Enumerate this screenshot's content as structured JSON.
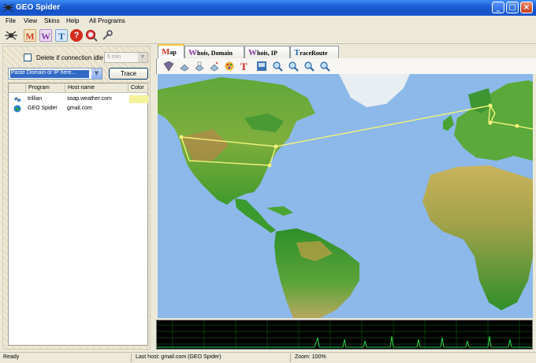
{
  "window": {
    "title": "GEO Spider"
  },
  "menu": [
    "File",
    "View",
    "Skins",
    "Help",
    "All Programs"
  ],
  "toolbar": {
    "buttons": [
      {
        "icon": "spider-icon"
      },
      {
        "icon": "map-m-icon",
        "glyph": "M"
      },
      {
        "icon": "whois-w-icon",
        "glyph": "W"
      },
      {
        "icon": "trace-t-icon",
        "glyph": "T"
      },
      {
        "icon": "help-icon",
        "glyph": "?"
      },
      {
        "icon": "globe-search-icon"
      },
      {
        "icon": "settings-icon"
      }
    ]
  },
  "left_panel": {
    "delete_idle_label": "Delete if connection idle",
    "idle_select_value": "5 min",
    "domain_input_placeholder": "Paste Domain or IP here...",
    "trace_button": "Trace",
    "columns": [
      "Program",
      "Host name",
      "Color"
    ],
    "rows": [
      {
        "program": "trillian",
        "host": "soap.weather.com",
        "color": "#f6f29a"
      },
      {
        "program": "GEO Spider",
        "host": "gmail.com",
        "color": ""
      }
    ]
  },
  "tabs": [
    {
      "first": "M",
      "rest": "ap",
      "active": true
    },
    {
      "first": "W",
      "rest": "hois, Domain",
      "active": false
    },
    {
      "first": "W",
      "rest": "hois, IP",
      "active": false
    },
    {
      "first": "T",
      "rest": "raceRoute",
      "active": false
    }
  ],
  "map_toolbar": [
    "map-icon",
    "open-icon",
    "print-icon",
    "save-icon",
    "palette-icon",
    "text-icon",
    "export-icon",
    "zoom-in-icon",
    "zoom-out-icon",
    "zoom-fit-icon",
    "zoom-reset-icon"
  ],
  "map": {
    "route_color": "#f2f27a",
    "ocean_color": "#8cb9e9"
  },
  "status": {
    "state": "Ready",
    "last_host": "Last host: gmail.com (GEO Spider)",
    "zoom": "Zoom: 100%"
  }
}
